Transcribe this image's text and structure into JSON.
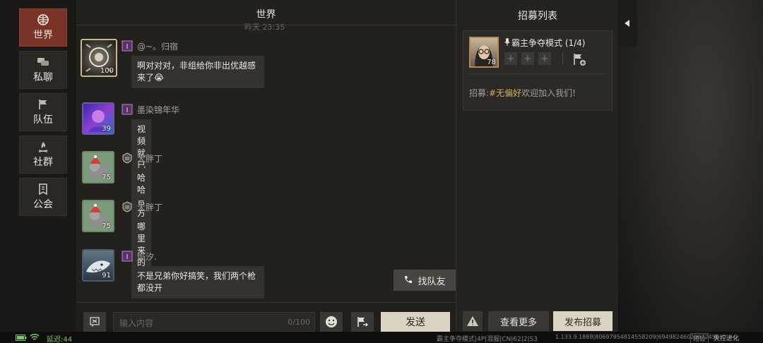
{
  "nav": [
    {
      "label": "世界",
      "icon": "globe-icon"
    },
    {
      "label": "私聊",
      "icon": "chat-bubbles-icon"
    },
    {
      "label": "队伍",
      "icon": "flag-icon"
    },
    {
      "label": "社群",
      "icon": "campfire-icon"
    },
    {
      "label": "公会",
      "icon": "banner-icon"
    }
  ],
  "chat": {
    "title": "世界",
    "time_stub": "昨天 23:35",
    "messages": [
      {
        "name": "@~。归宿",
        "text_lines": [
          "啊对对对，非组给你非出优越感",
          "来了😭"
        ],
        "level": "100"
      },
      {
        "name": "墨染锦年华",
        "text_lines": [
          "视频就已经 给官方了"
        ],
        "level": "39"
      },
      {
        "name": "大胖丁",
        "text_lines": [
          "哈哈"
        ],
        "level": "75"
      },
      {
        "name": "大胖丁",
        "text_lines": [
          "哪里来的乐子"
        ],
        "level": "75"
      },
      {
        "name": "焰汐.",
        "text_lines": [
          "不是兄弟你好搞笑，我们两个枪",
          "都没开"
        ],
        "level": "91"
      }
    ],
    "find_team_label": "找队友",
    "input_placeholder": "输入内容",
    "char_count": "0/100",
    "send_label": "发送"
  },
  "recruit": {
    "title": "招募列表",
    "card": {
      "mode": "霸主争夺模式 (1/4)",
      "level": "78",
      "msg_prefix": "招募:",
      "msg_tag": "#无偏好",
      "msg_suffix": "欢迎加入我们!"
    },
    "more_label": "查看更多",
    "post_label": "发布招募"
  },
  "status": {
    "latency": "延迟:44",
    "server": "霸主争夺模式|4P|混服|CN|62|2|S3",
    "version": "1.133.9.1889|80697954814558209|69498246029672450",
    "quality": "精致",
    "brand": "失控进化"
  },
  "colors": {
    "accent": "#7a3427",
    "send_bg": "#dcd4c2",
    "latency_green": "#7fc36a",
    "tag_gold": "#d2b05a"
  }
}
